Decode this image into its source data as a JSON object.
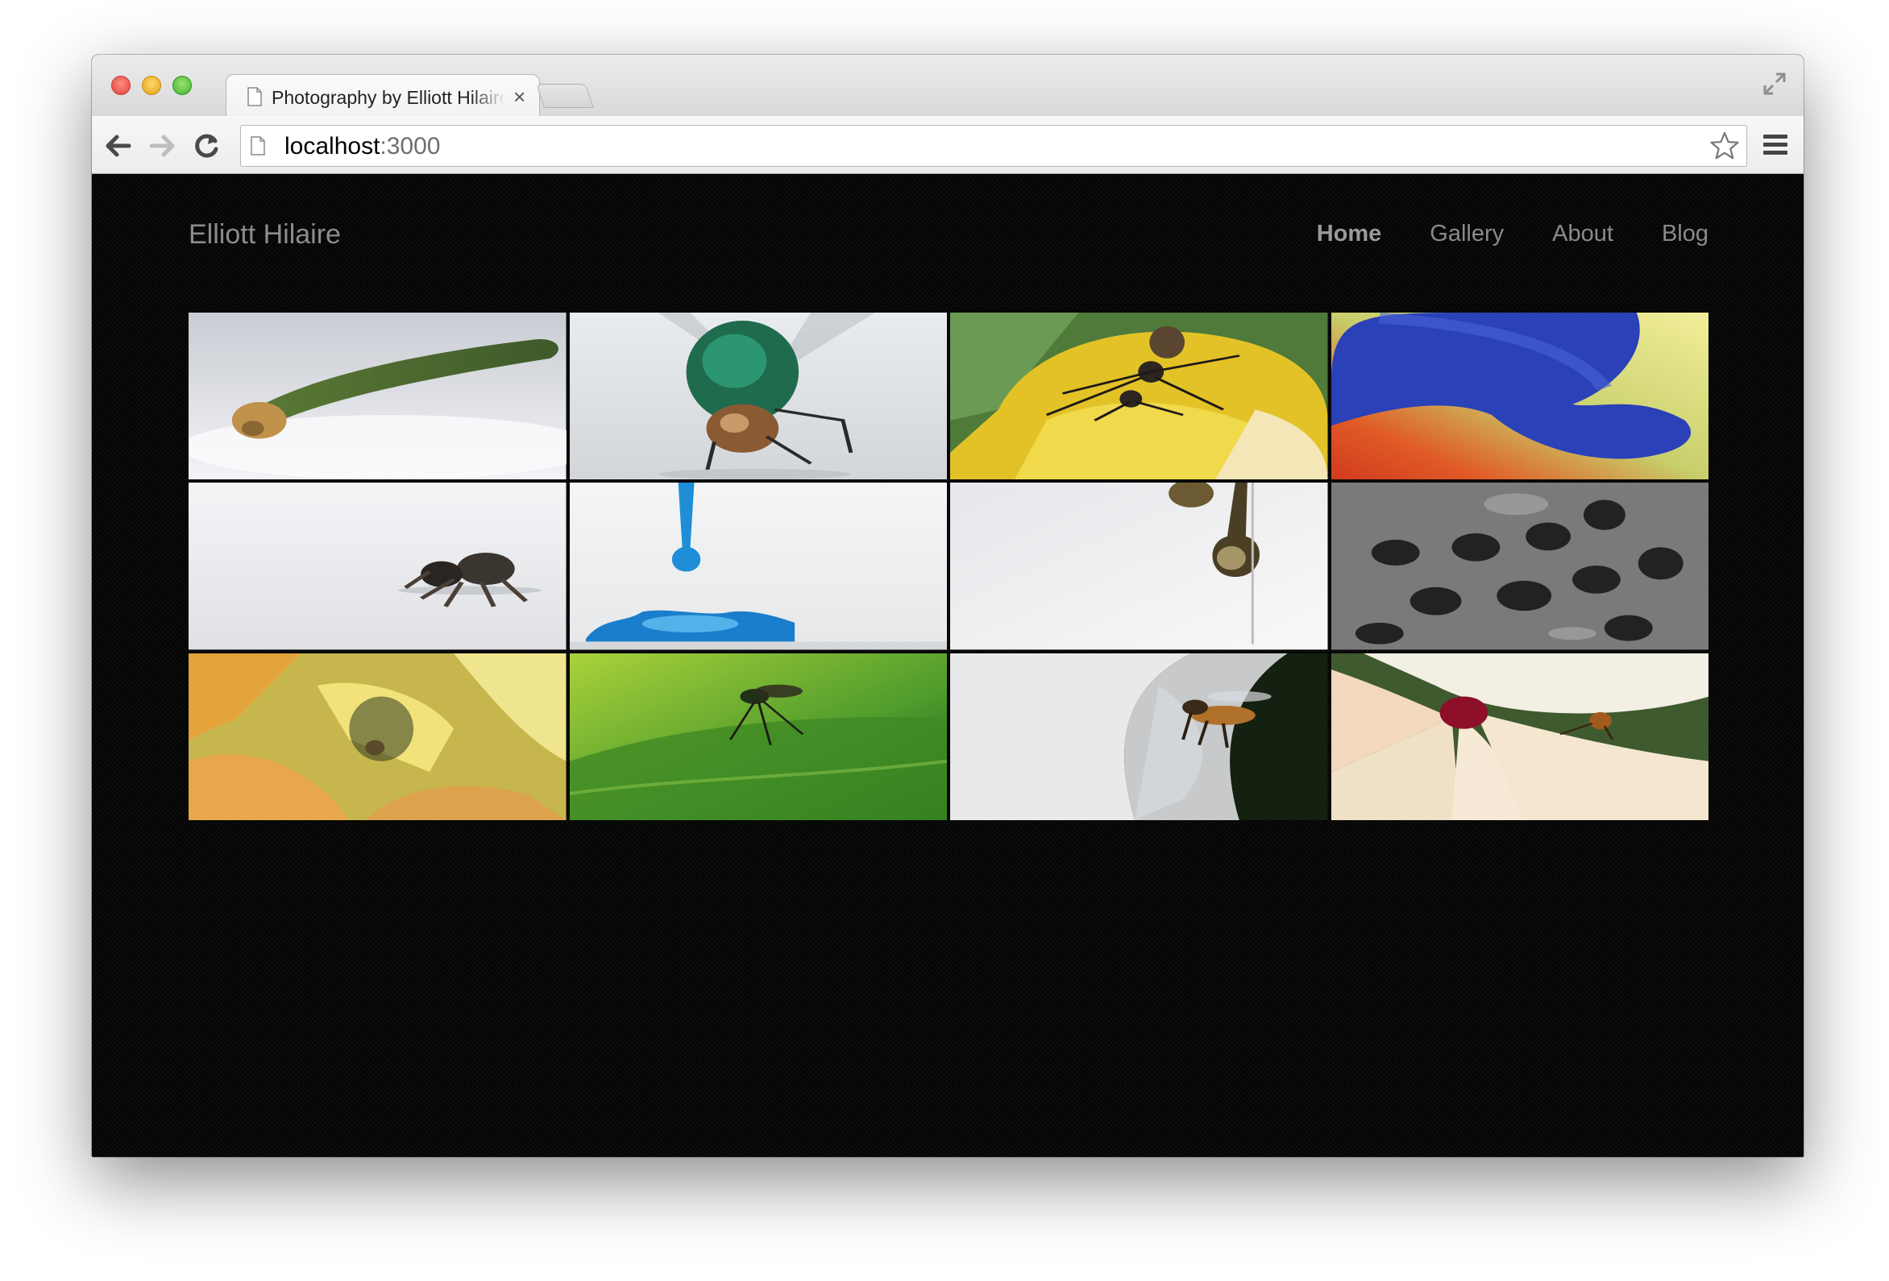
{
  "browser": {
    "tab_title": "Photography by Elliott Hilaire",
    "tab_close": "×",
    "url_host": "localhost",
    "url_port": ":3000"
  },
  "site": {
    "title": "Elliott Hilaire",
    "nav": [
      "Home",
      "Gallery",
      "About",
      "Blog"
    ],
    "active_nav": "Home"
  },
  "gallery": {
    "photos": [
      {
        "subject": "caterpillar"
      },
      {
        "subject": "fly"
      },
      {
        "subject": "ant on yellow flower"
      },
      {
        "subject": "blue petal"
      },
      {
        "subject": "jumping spider"
      },
      {
        "subject": "blue water drop"
      },
      {
        "subject": "honey drops"
      },
      {
        "subject": "honeycomb black and white"
      },
      {
        "subject": "insect in yellow flower"
      },
      {
        "subject": "fly on green leaf"
      },
      {
        "subject": "bee on white flower"
      },
      {
        "subject": "beetle on magnolia"
      }
    ]
  }
}
